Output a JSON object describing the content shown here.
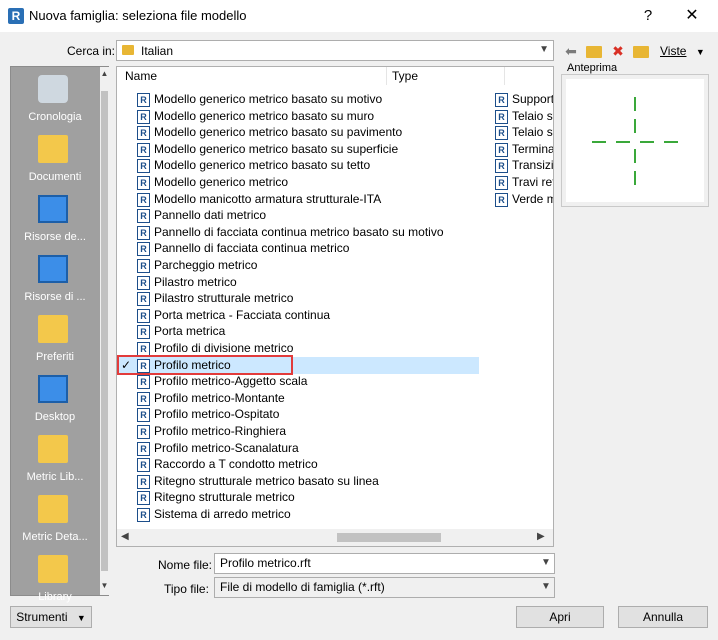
{
  "window": {
    "title": "Nuova famiglia: seleziona file modello",
    "app_icon": "R",
    "help_label": "?",
    "close_label": "✕"
  },
  "lookin": {
    "label": "Cerca in:",
    "value": "Italian"
  },
  "toolbar": {
    "back_icon": "back-arrow-icon",
    "up_icon": "up-folder-icon",
    "delete_icon": "delete-icon",
    "new_folder_icon": "new-folder-icon",
    "views_label": "Viste"
  },
  "places": [
    {
      "label": "Cronologia",
      "icon": "history-icon"
    },
    {
      "label": "Documenti",
      "icon": "documents-icon"
    },
    {
      "label": "Risorse de...",
      "icon": "computer-icon"
    },
    {
      "label": "Risorse di ...",
      "icon": "network-icon"
    },
    {
      "label": "Preferiti",
      "icon": "favorites-icon"
    },
    {
      "label": "Desktop",
      "icon": "desktop-icon"
    },
    {
      "label": "Metric Lib...",
      "icon": "folder-icon"
    },
    {
      "label": "Metric Deta...",
      "icon": "folder-icon"
    },
    {
      "label": "Library",
      "icon": "folder-icon"
    }
  ],
  "filelist": {
    "columns": {
      "name": "Name",
      "type": "Type"
    },
    "files": [
      "Modello generico metrico basato su motivo",
      "Modello generico metrico basato su muro",
      "Modello generico metrico basato su pavimento",
      "Modello generico metrico basato su superficie",
      "Modello generico metrico basato su tetto",
      "Modello generico metrico",
      "Modello manicotto armatura strutturale-ITA",
      "Pannello dati metrico",
      "Pannello di facciata continua metrico basato su motivo",
      "Pannello di facciata continua metrico",
      "Parcheggio metrico",
      "Pilastro metrico",
      "Pilastro strutturale metrico",
      "Porta metrica - Facciata continua",
      "Porta metrica",
      "Profilo di divisione metrico",
      "Profilo metrico",
      "Profilo metrico-Aggetto scala",
      "Profilo metrico-Montante",
      "Profilo metrico-Ospitato",
      "Profilo metrico-Ringhiera",
      "Profilo metrico-Scanalatura",
      "Raccordo a T condotto metrico",
      "Ritegno strutturale metrico basato su linea",
      "Ritegno strutturale metrico",
      "Sistema di arredo metrico"
    ],
    "selected_index": 16,
    "right_column": [
      "Support",
      "Telaio st",
      "Telaio st",
      "Termina",
      "Transizi",
      "Travi ret",
      "Verde m"
    ]
  },
  "preview": {
    "label": "Anteprima"
  },
  "filename": {
    "label": "Nome file:",
    "value": "Profilo metrico.rft"
  },
  "filetype": {
    "label": "Tipo file:",
    "value": "File di modello di famiglia  (*.rft)"
  },
  "buttons": {
    "tools": "Strumenti",
    "open": "Apri",
    "cancel": "Annulla"
  }
}
